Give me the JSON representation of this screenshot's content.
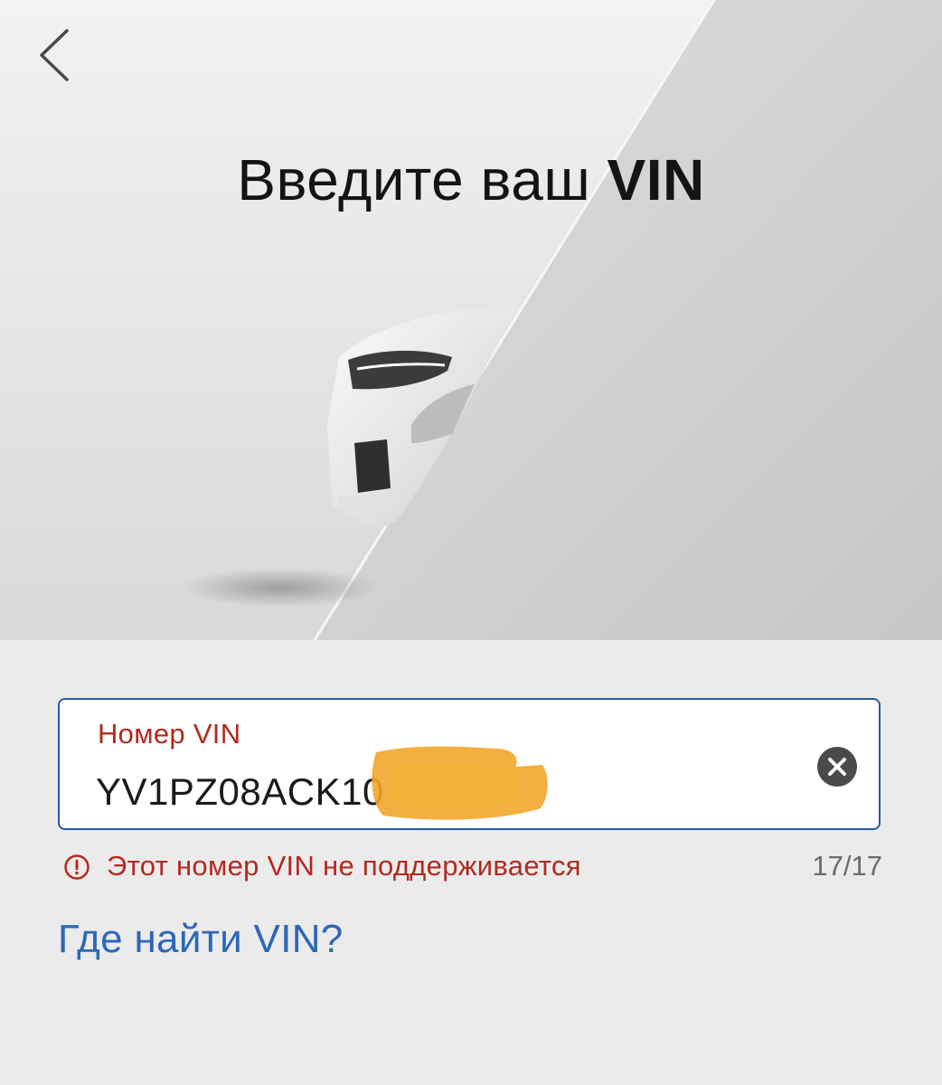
{
  "header": {
    "back_icon": "chevron-left-icon",
    "title_prefix": "Введите ваш",
    "title_bold": "VIN"
  },
  "vin_field": {
    "label": "Номер VIN",
    "value": "YV1PZ08ACK10",
    "clear_icon": "clear-circle-icon"
  },
  "error": {
    "icon": "exclamation-circle-icon",
    "message": "Этот номер VIN не поддерживается",
    "count": "17/17"
  },
  "help": {
    "link_label": "Где найти VIN?"
  },
  "colors": {
    "accent_blue": "#2d59a6",
    "link_blue": "#2d67b8",
    "error_red": "#b3291f",
    "redaction_orange": "#f2a62a"
  }
}
